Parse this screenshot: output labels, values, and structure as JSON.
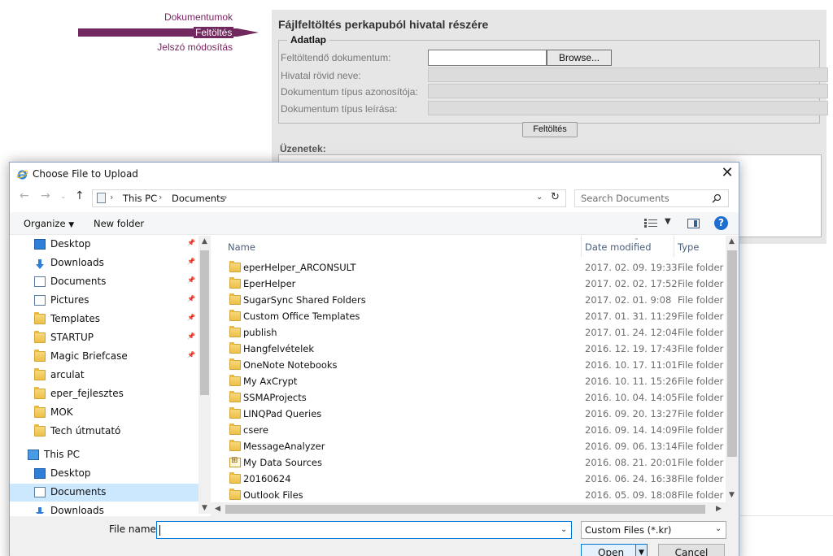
{
  "webpage": {
    "nav": {
      "documents": "Dokumentumok",
      "upload": "Feltöltés",
      "password": "Jelszó módosítás"
    },
    "panel_title": "Fájlfeltöltés perkapuból hivatal részére",
    "legend": "Adatlap",
    "form": {
      "document_label": "Feltöltendő dokumentum:",
      "browse_label": "Browse...",
      "office_label": "Hivatal rövid neve:",
      "doctype_id_label": "Dokumentum típus azonosítója:",
      "doctype_desc_label": "Dokumentum típus leírása:"
    },
    "upload_button": "Feltöltés",
    "messages_label": "Üzenetek:",
    "colors": {
      "nav_accent": "#70285e",
      "panel_bg": "#e6e6e6"
    }
  },
  "dialog": {
    "title": "Choose File to Upload",
    "address": {
      "crumbs": [
        "This PC",
        "Documents"
      ]
    },
    "search_placeholder": "Search Documents",
    "toolbar": {
      "organize": "Organize",
      "new_folder": "New folder"
    },
    "tree": [
      {
        "label": "Desktop",
        "icon": "desktop-icon",
        "pinned": true
      },
      {
        "label": "Downloads",
        "icon": "download-icon",
        "pinned": true
      },
      {
        "label": "Documents",
        "icon": "documents-icon",
        "pinned": true
      },
      {
        "label": "Pictures",
        "icon": "pictures-icon",
        "pinned": true
      },
      {
        "label": "Templates",
        "icon": "folder-icon",
        "pinned": true
      },
      {
        "label": "STARTUP",
        "icon": "folder-icon",
        "pinned": true
      },
      {
        "label": "Magic Briefcase",
        "icon": "folder-icon",
        "pinned": true
      },
      {
        "label": "arculat",
        "icon": "folder-icon",
        "pinned": false
      },
      {
        "label": "eper_fejlesztes",
        "icon": "folder-icon",
        "pinned": false
      },
      {
        "label": "MOK",
        "icon": "folder-icon",
        "pinned": false
      },
      {
        "label": "Tech útmutató",
        "icon": "folder-icon",
        "pinned": false
      },
      {
        "label": "This PC",
        "icon": "computer-icon",
        "pinned": false
      },
      {
        "label": "Desktop",
        "icon": "desktop-icon",
        "pinned": false
      },
      {
        "label": "Documents",
        "icon": "documents-icon",
        "pinned": false,
        "selected": true
      },
      {
        "label": "Downloads",
        "icon": "download-icon",
        "pinned": false
      }
    ],
    "columns": {
      "name": "Name",
      "date": "Date modified",
      "type": "Type"
    },
    "files": [
      {
        "name": "eperHelper_ARCONSULT",
        "date": "2017. 02. 09. 19:33",
        "type": "File folder"
      },
      {
        "name": "EperHelper",
        "date": "2017. 02. 02. 17:52",
        "type": "File folder"
      },
      {
        "name": "SugarSync Shared Folders",
        "date": "2017. 02. 01. 9:08",
        "type": "File folder"
      },
      {
        "name": "Custom Office Templates",
        "date": "2017. 01. 31. 11:29",
        "type": "File folder"
      },
      {
        "name": "publish",
        "date": "2017. 01. 24. 12:04",
        "type": "File folder"
      },
      {
        "name": "Hangfelvételek",
        "date": "2016. 12. 19. 17:43",
        "type": "File folder"
      },
      {
        "name": "OneNote Notebooks",
        "date": "2016. 10. 17. 11:01",
        "type": "File folder"
      },
      {
        "name": "My AxCrypt",
        "date": "2016. 10. 11. 15:26",
        "type": "File folder"
      },
      {
        "name": "SSMAProjects",
        "date": "2016. 10. 04. 14:05",
        "type": "File folder"
      },
      {
        "name": "LINQPad Queries",
        "date": "2016. 09. 20. 13:27",
        "type": "File folder"
      },
      {
        "name": "csere",
        "date": "2016. 09. 14. 14:09",
        "type": "File folder"
      },
      {
        "name": "MessageAnalyzer",
        "date": "2016. 09. 06. 13:14",
        "type": "File folder"
      },
      {
        "name": "My Data Sources",
        "date": "2016. 08. 21. 20:01",
        "type": "File folder",
        "icon": "data-sources-icon"
      },
      {
        "name": "20160624",
        "date": "2016. 06. 24. 16:38",
        "type": "File folder"
      },
      {
        "name": "Outlook Files",
        "date": "2016. 05. 09. 18:08",
        "type": "File folder"
      }
    ],
    "filename_label": "File name:",
    "filename_value": "",
    "filetype_selected": "Custom Files (*.kr)",
    "open_label": "Open",
    "cancel_label": "Cancel"
  }
}
